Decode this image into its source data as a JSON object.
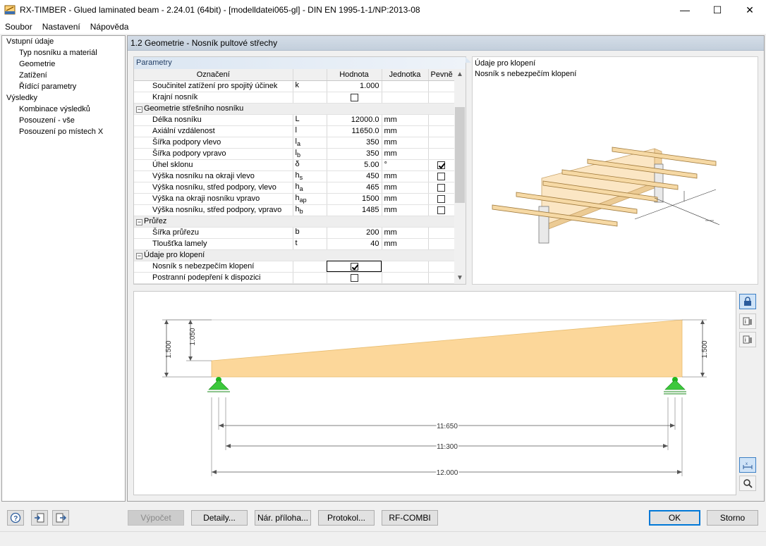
{
  "window": {
    "title": "RX-TIMBER - Glued laminated beam - 2.24.01 (64bit) - [modelldatei065-gl] - DIN EN 1995-1-1/NP:2013-08",
    "minimize": "—",
    "maximize": "☐",
    "close": "✕"
  },
  "menu": [
    "Soubor",
    "Nastavení",
    "Nápověda"
  ],
  "nav": [
    {
      "label": "Vstupní údaje",
      "level": 0
    },
    {
      "label": "Typ nosníku a materiál",
      "level": 1
    },
    {
      "label": "Geometrie",
      "level": 1
    },
    {
      "label": "Zatížení",
      "level": 1
    },
    {
      "label": "Řídící parametry",
      "level": 1
    },
    {
      "label": "Výsledky",
      "level": 0
    },
    {
      "label": "Kombinace výsledků",
      "level": 1
    },
    {
      "label": "Posouzení - vše",
      "level": 1
    },
    {
      "label": "Posouzení po místech X",
      "level": 1
    }
  ],
  "section_title": "1.2 Geometrie  -  Nosník pultové střechy",
  "params": {
    "panel_title": "Parametry",
    "headers": {
      "name": "Označení",
      "symbol": "",
      "value": "Hodnota",
      "unit": "Jednotka",
      "fixed": "Pevně"
    },
    "rows": [
      {
        "type": "row",
        "name": "Součinitel zatížení pro spojitý účinek",
        "sym": "k",
        "sub": "",
        "value": "1.000",
        "unit": "",
        "fixed": "none"
      },
      {
        "type": "row",
        "name": "Krajní nosník",
        "sym": "",
        "sub": "",
        "value": "",
        "valueCheckbox": "unchecked",
        "unit": "",
        "fixed": "none"
      },
      {
        "type": "group",
        "name": "Geometrie střešního nosníku"
      },
      {
        "type": "row",
        "name": "Délka nosníku",
        "sym": "L",
        "sub": "",
        "value": "12000.0",
        "unit": "mm",
        "fixed": "none"
      },
      {
        "type": "row",
        "name": "Axiální vzdálenost",
        "sym": "l",
        "sub": "",
        "value": "11650.0",
        "unit": "mm",
        "fixed": "none"
      },
      {
        "type": "row",
        "name": "Šířka podpory vlevo",
        "sym": "l",
        "sub": "a",
        "value": "350",
        "unit": "mm",
        "fixed": "none"
      },
      {
        "type": "row",
        "name": "Šířka podpory vpravo",
        "sym": "l",
        "sub": "b",
        "value": "350",
        "unit": "mm",
        "fixed": "none"
      },
      {
        "type": "row",
        "name": "Úhel sklonu",
        "sym": "δ",
        "sub": "",
        "value": "5.00",
        "unit": "°",
        "fixed": "checked"
      },
      {
        "type": "row",
        "name": "Výška nosníku na okraji vlevo",
        "sym": "h",
        "sub": "s",
        "value": "450",
        "unit": "mm",
        "fixed": "unchecked"
      },
      {
        "type": "row",
        "name": "Výška nosníku, střed podpory, vlevo",
        "sym": "h",
        "sub": "a",
        "value": "465",
        "unit": "mm",
        "fixed": "unchecked"
      },
      {
        "type": "row",
        "name": "Výška na okraji nosníku vpravo",
        "sym": "h",
        "sub": "ap",
        "value": "1500",
        "unit": "mm",
        "fixed": "unchecked"
      },
      {
        "type": "row",
        "name": "Výška nosníku, střed podpory, vpravo",
        "sym": "h",
        "sub": "b",
        "value": "1485",
        "unit": "mm",
        "fixed": "unchecked"
      },
      {
        "type": "group",
        "name": "Průřez"
      },
      {
        "type": "row",
        "name": "Šířka průřezu",
        "sym": "b",
        "sub": "",
        "value": "200",
        "unit": "mm",
        "fixed": "none"
      },
      {
        "type": "row",
        "name": "Tloušťka lamely",
        "sym": "t",
        "sub": "",
        "value": "40",
        "unit": "mm",
        "fixed": "none"
      },
      {
        "type": "group",
        "name": "Údaje pro klopení"
      },
      {
        "type": "row",
        "name": "Nosník s nebezpečím klopení",
        "sym": "",
        "sub": "",
        "value": "",
        "valueCheckbox": "checked",
        "focus": true,
        "unit": "",
        "fixed": "none"
      },
      {
        "type": "row",
        "name": "Postranní podepření k dispozici",
        "sym": "",
        "sub": "",
        "value": "",
        "valueCheckbox": "unchecked",
        "unit": "",
        "fixed": "none"
      }
    ]
  },
  "preview": {
    "title": "Údaje pro klopení",
    "subtitle": "Nosník s nebezpečím klopení"
  },
  "drawing": {
    "dim_left_total": "1.500",
    "dim_left_inner": "1.050",
    "dim_right": "1.500",
    "dim_axial": "11.650",
    "dim_middle": "11.300",
    "dim_total": "12.000"
  },
  "buttons": {
    "calculate": "Výpočet",
    "details": "Detaily...",
    "national_annex": "Nár. příloha...",
    "report": "Protokol...",
    "rfcombi": "RF-COMBI",
    "ok": "OK",
    "cancel": "Storno"
  },
  "colors": {
    "beam": "#fcd79a",
    "support": "#1fb81f",
    "accent": "#0078d7"
  }
}
